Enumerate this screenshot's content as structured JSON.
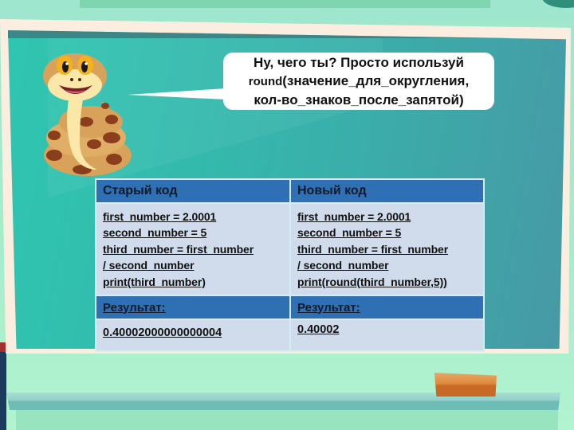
{
  "speech_bubble": {
    "line1": "Ну, чего ты? Просто используй",
    "line2_func": "round",
    "line2_rest": "(значение_для_округления,",
    "line3": "кол-во_знаков_после_запятой)"
  },
  "mascot": {
    "icon": "snake-mascot-icon"
  },
  "table": {
    "headers": [
      "Старый код",
      "Новый код"
    ],
    "old_code": [
      "first_number = 2.0001",
      "second_number = 5",
      "third_number = first_number",
      "/ second_number",
      "print(third_number)"
    ],
    "new_code": [
      "first_number = 2.0001",
      "second_number = 5",
      "third_number = first_number",
      "/ second_number",
      "print(round(third_number,5))"
    ],
    "result_headers": [
      "Результат:",
      "Результат:"
    ],
    "results": [
      "0.40002000000000004",
      "0.40002"
    ]
  },
  "colors": {
    "header_blue": "#2f6fb3",
    "cell_light": "#d0dceb",
    "board_teal": "#36b5ac",
    "eraser_orange": "#e08a3c"
  }
}
